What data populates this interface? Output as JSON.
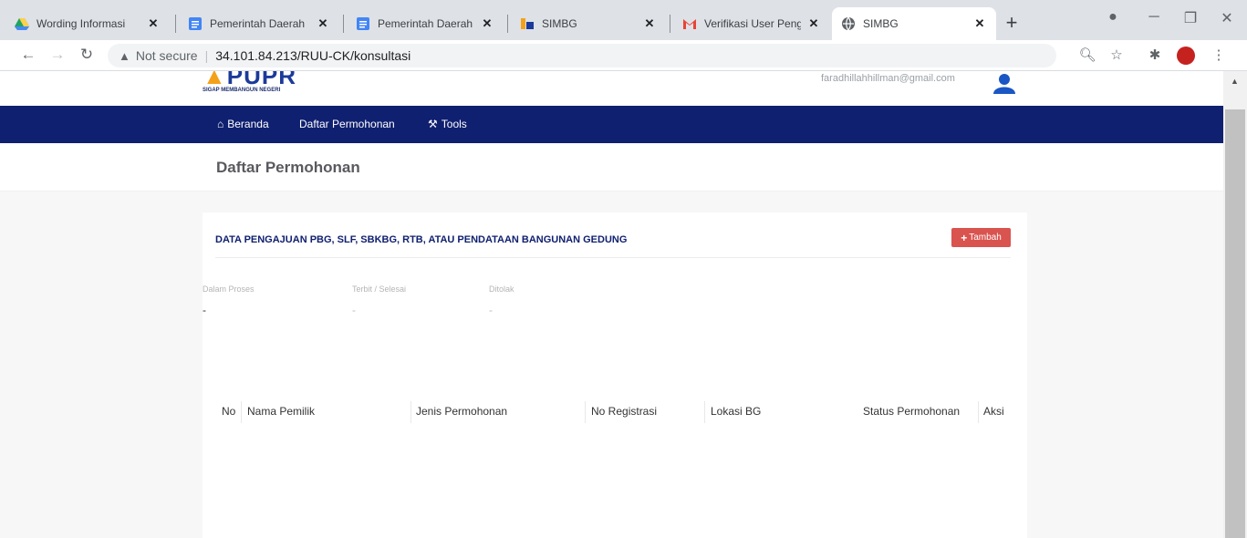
{
  "browser": {
    "tabs": [
      {
        "title": "Wording Informasi",
        "icon": "google-drive-icon"
      },
      {
        "title": "Pemerintah Daerah",
        "icon": "google-docs-icon"
      },
      {
        "title": "Pemerintah Daerah",
        "icon": "google-docs-icon"
      },
      {
        "title": "SIMBG",
        "icon": "simbg-icon"
      },
      {
        "title": "Verifikasi User Peng",
        "icon": "gmail-icon"
      },
      {
        "title": "SIMBG",
        "icon": "globe-icon"
      }
    ],
    "new_tab": "+",
    "address": {
      "security_label": "Not secure",
      "url": "34.101.84.213/RUU-CK/konsultasi"
    }
  },
  "site": {
    "logo_text_main": "PUPR",
    "logo_tagline": "SIGAP MEMBANGUN NEGERI",
    "user_email": "faradhillahhillman@gmail.com",
    "nav": [
      {
        "label": "Beranda",
        "icon": "home-icon"
      },
      {
        "label": "Daftar Permohonan"
      },
      {
        "label": "Tools",
        "icon": "wrench-icon"
      }
    ],
    "page_title": "Daftar Permohonan"
  },
  "card": {
    "title": "DATA PENGAJUAN PBG, SLF, SBKBG, RTB, ATAU PENDATAAN BANGUNAN GEDUNG",
    "add_button": "Tambah",
    "stats": [
      {
        "label": "Dalam Proses",
        "value": "-"
      },
      {
        "label": "Terbit / Selesai",
        "value": "-"
      },
      {
        "label": "Ditolak",
        "value": "-"
      }
    ],
    "columns": [
      "No",
      "Nama Pemilik",
      "Jenis Permohonan",
      "No Registrasi",
      "Lokasi BG",
      "Status Permohonan",
      "Aksi"
    ]
  },
  "colors": {
    "nav_bg": "#102070",
    "add_button_bg": "#d9534f",
    "title_text": "#102070"
  }
}
